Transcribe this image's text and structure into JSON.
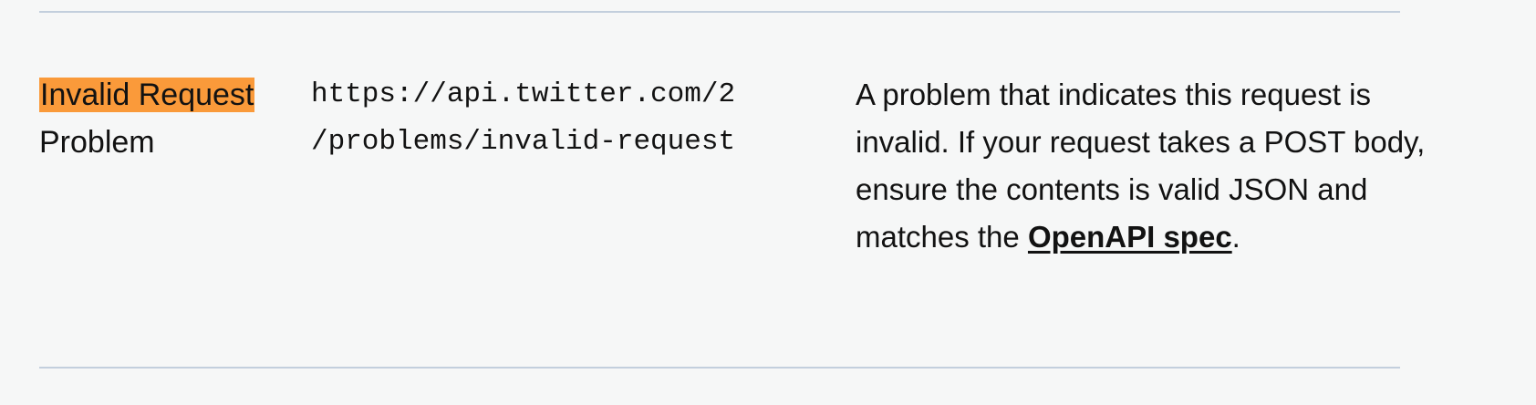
{
  "problem": {
    "name_highlighted": "Invalid Request",
    "name_rest": "Problem",
    "url_line1": "https://api.twitter.com/2",
    "url_line2": "/problems/invalid-request",
    "description_before_link": "A problem that indicates this request is invalid. If your request takes a POST body, ensure the contents is valid JSON and matches the ",
    "link_label": "OpenAPI spec",
    "description_after_link": "."
  },
  "colors": {
    "highlight": "#fa9a3a",
    "divider": "#c3cfdd"
  }
}
